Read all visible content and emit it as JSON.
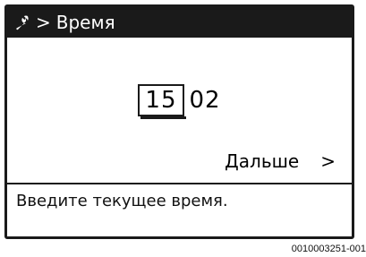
{
  "header": {
    "icon": "wrench-icon",
    "separator": ">",
    "title": "Время"
  },
  "time": {
    "hours": "15",
    "minutes": "02"
  },
  "navigation": {
    "next_label": "Дальше",
    "next_chevron": ">"
  },
  "hint": "Введите текущее время.",
  "doc_id": "0010003251-001"
}
